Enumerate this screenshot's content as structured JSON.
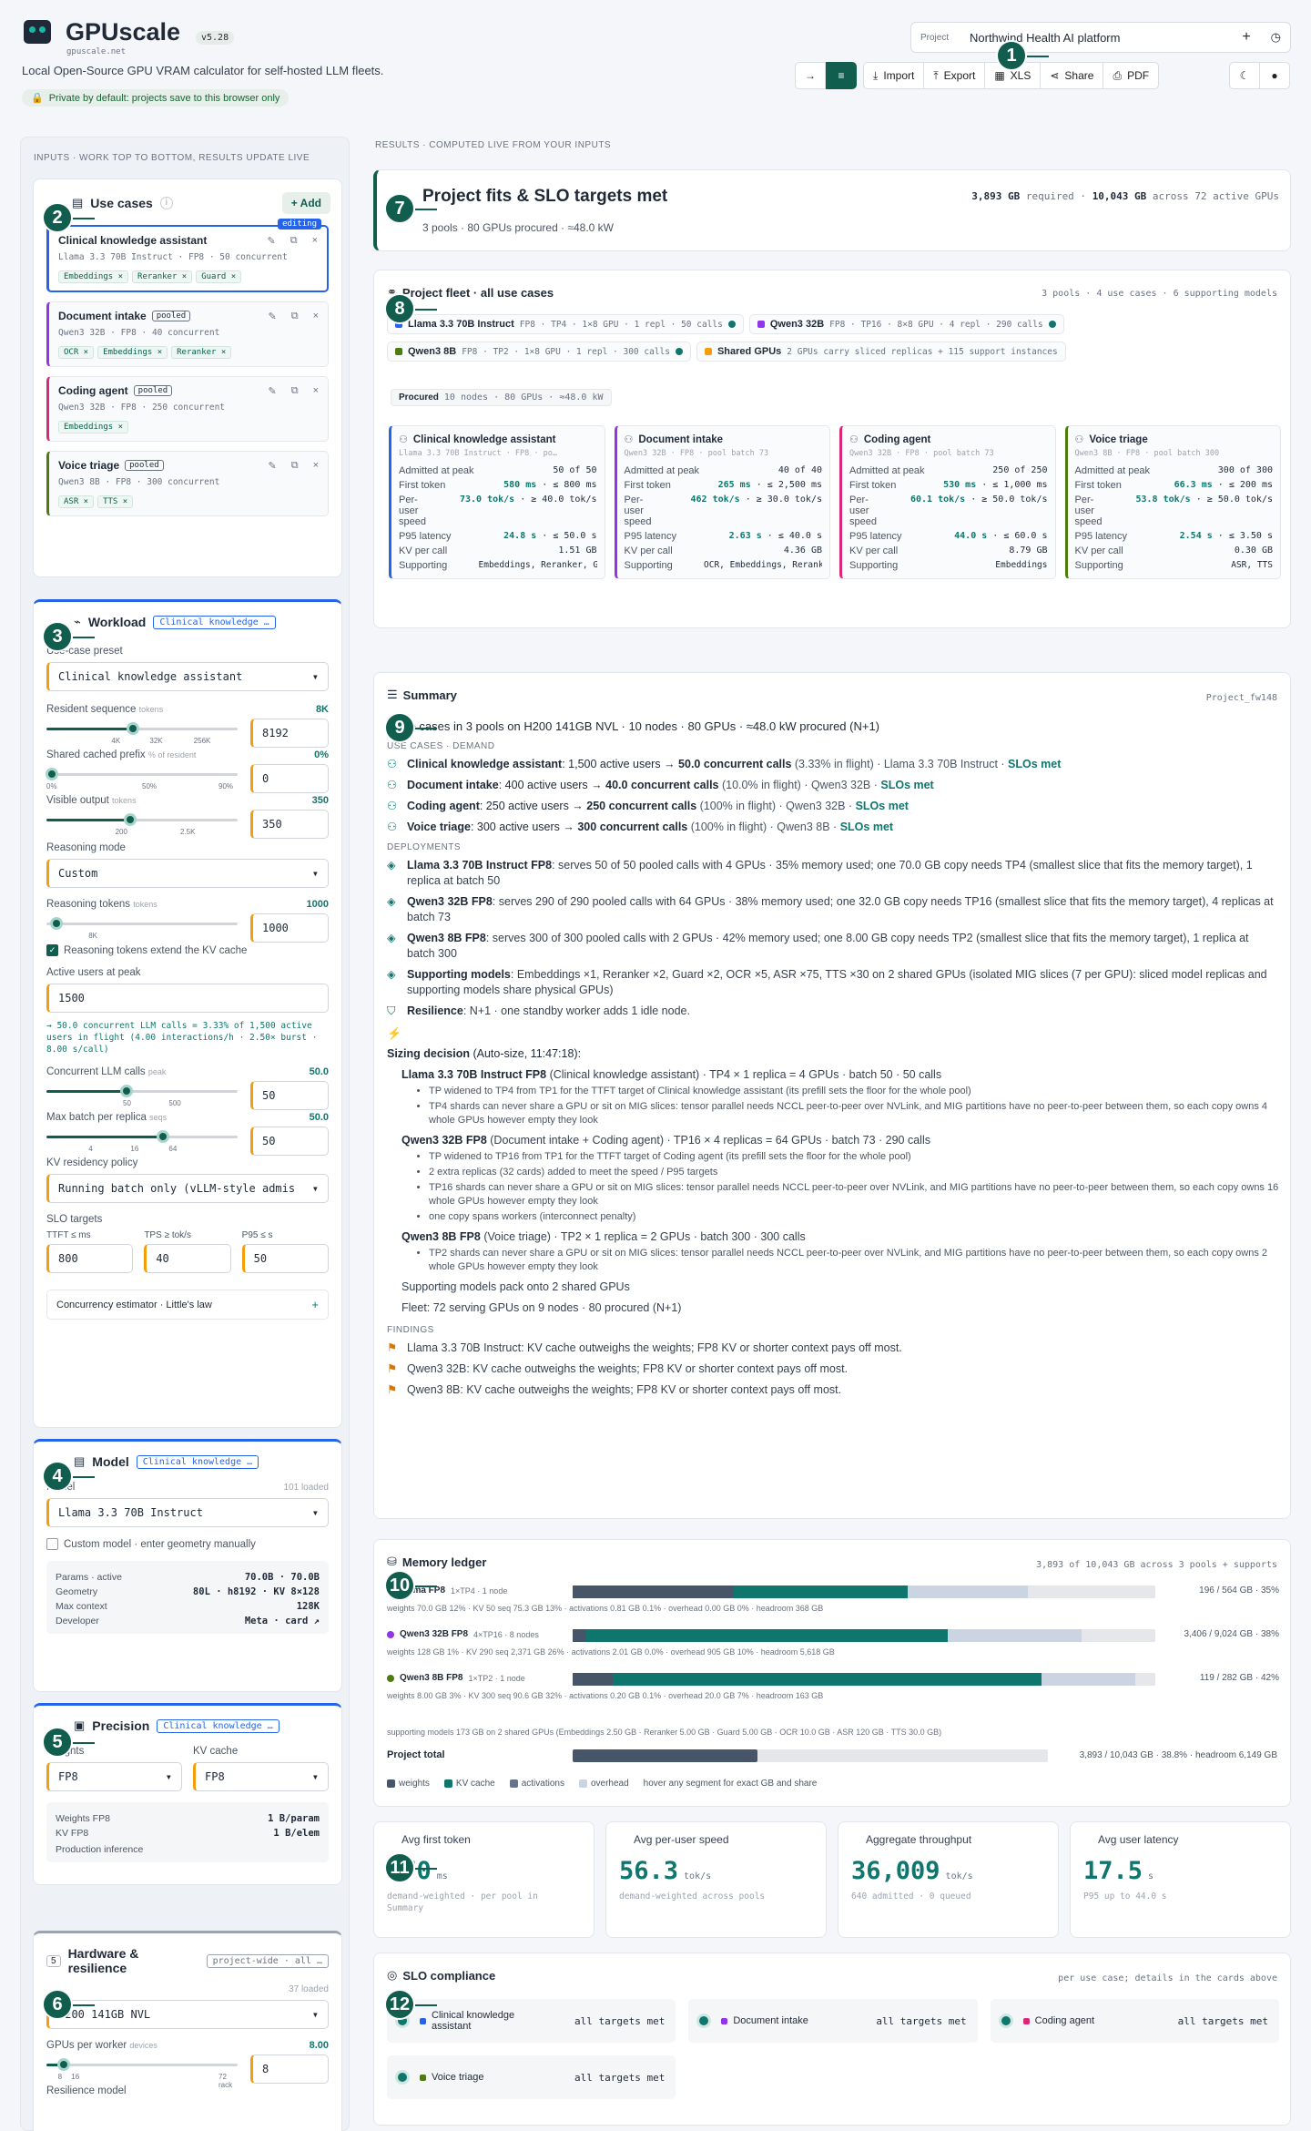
{
  "header": {
    "app_title": "GPUscale",
    "version": "v5.28",
    "site": "gpuscale.net",
    "tagline": "Local Open-Source GPU VRAM calculator for self-hosted LLM fleets.",
    "privacy": "Private by default: projects save to this browser only",
    "project_label": "Project",
    "project_name": "Northwind Health AI platform",
    "buttons": {
      "import": "Import",
      "export": "Export",
      "xls": "XLS",
      "share": "Share",
      "pdf": "PDF"
    }
  },
  "inputs_label": "INPUTS · WORK TOP TO BOTTOM, RESULTS UPDATE LIVE",
  "results_label": "RESULTS · COMPUTED LIVE FROM YOUR INPUTS",
  "usecases": {
    "title": "Use cases",
    "add": "+ Add",
    "editing_badge": "editing",
    "pooled_badge": "pooled",
    "items": [
      {
        "name": "Clinical knowledge assistant",
        "meta": "Llama 3.3 70B Instruct · FP8 · 50 concurrent",
        "chips": [
          "Embeddings ×",
          "Reranker ×",
          "Guard ×"
        ],
        "color": "#2563eb"
      },
      {
        "name": "Document intake",
        "meta": "Qwen3 32B · FP8 · 40 concurrent",
        "chips": [
          "OCR ×",
          "Embeddings ×",
          "Reranker ×"
        ],
        "color": "#9333ea"
      },
      {
        "name": "Coding agent",
        "meta": "Qwen3 32B · FP8 · 250 concurrent",
        "chips": [
          "Embeddings ×"
        ],
        "color": "#db2777"
      },
      {
        "name": "Voice triage",
        "meta": "Qwen3 8B · FP8 · 300 concurrent",
        "chips": [
          "ASR ×",
          "TTS ×"
        ],
        "color": "#4d7c0f"
      }
    ]
  },
  "workload": {
    "title": "Workload",
    "tag": "Clinical knowledge …",
    "preset_label": "Use-case preset",
    "preset": "Clinical knowledge assistant",
    "resident_label": "Resident sequence",
    "resident_unit": "tokens",
    "resident_value": "8K",
    "resident_input": "8192",
    "resident_ticks": [
      "4K",
      "32K",
      "256K"
    ],
    "prefix_label": "Shared cached prefix",
    "prefix_unit": "% of resident",
    "prefix_value": "0%",
    "prefix_input": "0",
    "prefix_ticks": [
      "0%",
      "50%",
      "90%"
    ],
    "visible_label": "Visible output",
    "visible_unit": "tokens",
    "visible_value": "350",
    "visible_input": "350",
    "visible_ticks": [
      "200",
      "2.5K"
    ],
    "reasoning_mode_label": "Reasoning mode",
    "reasoning_mode": "Custom",
    "reasoning_tokens_label": "Reasoning tokens",
    "reasoning_tokens_unit": "tokens",
    "reasoning_tokens_value": "1000",
    "reasoning_input": "1000",
    "reasoning_ticks": [
      "8K"
    ],
    "kv_extend": "Reasoning tokens extend the KV cache",
    "active_label": "Active users at peak",
    "active_input": "1500",
    "active_note": "→ 50.0 concurrent LLM calls = 3.33% of 1,500 active users in flight (4.00 interactions/h · 2.50× burst · 8.00 s/call)",
    "conc_label": "Concurrent LLM calls",
    "conc_unit": "peak",
    "conc_value": "50.0",
    "conc_input": "50",
    "conc_ticks": [
      "50",
      "500"
    ],
    "batch_label": "Max batch per replica",
    "batch_unit": "seqs",
    "batch_value": "50.0",
    "batch_input": "50",
    "batch_ticks": [
      "4",
      "16",
      "64"
    ],
    "kvpol_label": "KV residency policy",
    "kvpol": "Running batch only (vLLM-style admis",
    "slo_label": "SLO targets",
    "ttft_label": "TTFT ≤ ms",
    "tps_label": "TPS ≥ tok/s",
    "p95_label": "P95 ≤ s",
    "ttft": "800",
    "tps": "40",
    "p95": "50",
    "estimator": "Concurrency estimator · Little's law"
  },
  "model": {
    "title": "Model",
    "tag": "Clinical knowledge …",
    "model_label": "Model",
    "loaded": "101 loaded",
    "model": "Llama 3.3 70B Instruct",
    "custom": "Custom model · enter geometry manually",
    "specs": [
      {
        "k": "Params · active",
        "v": "70.0B · 70.0B"
      },
      {
        "k": "Geometry",
        "v": "80L · h8192 · KV 8×128"
      },
      {
        "k": "Max context",
        "v": "128K"
      },
      {
        "k": "Developer",
        "v": "Meta · card ↗"
      }
    ]
  },
  "precision": {
    "title": "Precision",
    "tag": "Clinical knowledge …",
    "weights_label": "Weights",
    "kv_label": "KV cache",
    "weights": "FP8",
    "kv": "FP8",
    "specs": [
      {
        "k": "Weights FP8",
        "v": "1 B/param"
      },
      {
        "k": "KV FP8",
        "v": "1 B/elem"
      }
    ],
    "note": "Production inference"
  },
  "hardware": {
    "title": "Hardware & resilience",
    "tag": "project-wide · all …",
    "loaded": "37 loaded",
    "gpu": "H200 141GB NVL",
    "gpw_label": "GPUs per worker",
    "gpw_unit": "devices",
    "gpw_value": "8.00",
    "gpw_input": "8",
    "gpw_ticks": [
      "8",
      "16",
      "72 rack"
    ],
    "resilience_label": "Resilience model"
  },
  "hero": {
    "title": "Project fits & SLO targets met",
    "sub": "3 pools · 80 GPUs procured · ≈48.0 kW",
    "req_num": "3,893 GB",
    "req_txt": "required ·",
    "avail_num": "10,043 GB",
    "avail_txt": "across 72 active GPUs"
  },
  "fleet": {
    "title": "Project fleet · all use cases",
    "meta": "3 pools · 4 use cases · 6 supporting models",
    "pools": [
      {
        "name": "Llama 3.3 70B Instruct",
        "detail": "FP8 · TP4 · 1×8 GPU · 1 repl · 50 calls",
        "color": "#2563eb"
      },
      {
        "name": "Qwen3 32B",
        "detail": "FP8 · TP16 · 8×8 GPU · 4 repl · 290 calls",
        "color": "#9333ea"
      },
      {
        "name": "Qwen3 8B",
        "detail": "FP8 · TP2 · 1×8 GPU · 1 repl · 300 calls",
        "color": "#4d7c0f"
      },
      {
        "name": "Shared GPUs",
        "detail": "2 GPUs carry sliced replicas + 115 support instances",
        "color": "#f59e0b"
      }
    ],
    "procured_label": "Procured",
    "procured": "10 nodes · 80 GPUs · ≈48.0 kW",
    "cards": [
      {
        "name": "Clinical knowledge assistant",
        "sub": "Llama 3.3 70B Instruct · FP8 · po…",
        "color": "#2563eb",
        "admitted": "50 of 50",
        "first": "580 ms",
        "first_t": "≤ 800 ms",
        "speed": "73.0 tok/s",
        "speed_t": "≥ 40.0 tok/s",
        "p95": "24.8 s",
        "p95_t": "≤ 50.0 s",
        "kv": "1.51 GB",
        "supporting": "Embeddings, Reranker, Guar"
      },
      {
        "name": "Document intake",
        "sub": "Qwen3 32B · FP8 · pool batch 73",
        "color": "#9333ea",
        "admitted": "40 of 40",
        "first": "265 ms",
        "first_t": "≤ 2,500 ms",
        "speed": "462 tok/s",
        "speed_t": "≥ 30.0 tok/s",
        "p95": "2.63 s",
        "p95_t": "≤ 40.0 s",
        "kv": "4.36 GB",
        "supporting": "OCR, Embeddings, Reranker"
      },
      {
        "name": "Coding agent",
        "sub": "Qwen3 32B · FP8 · pool batch 73",
        "color": "#db2777",
        "admitted": "250 of 250",
        "first": "530 ms",
        "first_t": "≤ 1,000 ms",
        "speed": "60.1 tok/s",
        "speed_t": "≥ 50.0 tok/s",
        "p95": "44.0 s",
        "p95_t": "≤ 60.0 s",
        "kv": "8.79 GB",
        "supporting": "Embeddings"
      },
      {
        "name": "Voice triage",
        "sub": "Qwen3 8B · FP8 · pool batch 300",
        "color": "#4d7c0f",
        "admitted": "300 of 300",
        "first": "66.3 ms",
        "first_t": "≤ 200 ms",
        "speed": "53.8 tok/s",
        "speed_t": "≥ 50.0 tok/s",
        "p95": "2.54 s",
        "p95_t": "≤ 3.50 s",
        "kv": "0.30 GB",
        "supporting": "ASR, TTS"
      }
    ],
    "labels": {
      "admitted": "Admitted at peak",
      "first": "First token",
      "speed": "Per-user speed",
      "p95": "P95 latency",
      "kv": "KV per call",
      "supporting": "Supporting"
    }
  },
  "summary": {
    "title": "Summary",
    "id": "Project_fw148",
    "lead": "4 use cases in 3 pools on H200 141GB NVL · 10 nodes · 80 GPUs · ≈48.0 kW procured (N+1)",
    "demand_label": "USE CASES · DEMAND",
    "demand": [
      {
        "name": "Clinical knowledge assistant",
        "a": ": 1,500 active users → ",
        "b": "50.0 concurrent calls",
        "c": " (3.33% in flight) · Llama 3.3 70B Instruct · ",
        "d": "SLOs met"
      },
      {
        "name": "Document intake",
        "a": ": 400 active users → ",
        "b": "40.0 concurrent calls",
        "c": " (10.0% in flight) · Qwen3 32B · ",
        "d": "SLOs met"
      },
      {
        "name": "Coding agent",
        "a": ": 250 active users → ",
        "b": "250 concurrent calls",
        "c": " (100% in flight) · Qwen3 32B · ",
        "d": "SLOs met"
      },
      {
        "name": "Voice triage",
        "a": ": 300 active users → ",
        "b": "300 concurrent calls",
        "c": " (100% in flight) · Qwen3 8B · ",
        "d": "SLOs met"
      }
    ],
    "deploy_label": "DEPLOYMENTS",
    "deployments": [
      {
        "name": "Llama 3.3 70B Instruct FP8",
        "text": ": serves 50 of 50 pooled calls with 4 GPUs · 35% memory used; one 70.0 GB copy needs TP4 (smallest slice that fits the memory target), 1 replica at batch 50"
      },
      {
        "name": "Qwen3 32B FP8",
        "text": ": serves 290 of 290 pooled calls with 64 GPUs · 38% memory used; one 32.0 GB copy needs TP16 (smallest slice that fits the memory target), 4 replicas at batch 73"
      },
      {
        "name": "Qwen3 8B FP8",
        "text": ": serves 300 of 300 pooled calls with 2 GPUs · 42% memory used; one 8.00 GB copy needs TP2 (smallest slice that fits the memory target), 1 replica at batch 300"
      },
      {
        "name": "Supporting models",
        "text": ": Embeddings ×1, Reranker ×2, Guard ×2, OCR ×5, ASR ×75, TTS ×30 on 2 shared GPUs (isolated MIG slices (7 per GPU): sliced model replicas and supporting models share physical GPUs)"
      },
      {
        "name": "Resilience",
        "text": ": N+1 · one standby worker adds 1 idle node."
      }
    ],
    "sizing_title": "Sizing decision",
    "sizing_meta": " (Auto-size, 11:47:18):",
    "sizing": [
      {
        "head": "Llama 3.3 70B Instruct FP8",
        "rest": " (Clinical knowledge assistant) · TP4 × 1 replica = 4 GPUs · batch 50 · 50 calls",
        "bullets": [
          "TP widened to TP4 from TP1 for the TTFT target of Clinical knowledge assistant (its prefill sets the floor for the whole pool)",
          "TP4 shards can never share a GPU or sit on MIG slices: tensor parallel needs NCCL peer-to-peer over NVLink, and MIG partitions have no peer-to-peer between them, so each copy owns 4 whole GPUs however empty they look"
        ]
      },
      {
        "head": "Qwen3 32B FP8",
        "rest": " (Document intake + Coding agent) · TP16 × 4 replicas = 64 GPUs · batch 73 · 290 calls",
        "bullets": [
          "TP widened to TP16 from TP1 for the TTFT target of Coding agent (its prefill sets the floor for the whole pool)",
          "2 extra replicas (32 cards) added to meet the speed / P95 targets",
          "TP16 shards can never share a GPU or sit on MIG slices: tensor parallel needs NCCL peer-to-peer over NVLink, and MIG partitions have no peer-to-peer between them, so each copy owns 16 whole GPUs however empty they look",
          "one copy spans workers (interconnect penalty)"
        ]
      },
      {
        "head": "Qwen3 8B FP8",
        "rest": " (Voice triage) · TP2 × 1 replica = 2 GPUs · batch 300 · 300 calls",
        "bullets": [
          "TP2 shards can never share a GPU or sit on MIG slices: tensor parallel needs NCCL peer-to-peer over NVLink, and MIG partitions have no peer-to-peer between them, so each copy owns 2 whole GPUs however empty they look"
        ]
      }
    ],
    "sizing_tail": [
      "Supporting models pack onto 2 shared GPUs",
      "Fleet: 72 serving GPUs on 9 nodes · 80 procured (N+1)"
    ],
    "findings_label": "FINDINGS",
    "findings": [
      "Llama 3.3 70B Instruct: KV cache outweighs the weights; FP8 KV or shorter context pays off most.",
      "Qwen3 32B: KV cache outweighs the weights; FP8 KV or shorter context pays off most.",
      "Qwen3 8B: KV cache outweighs the weights; FP8 KV or shorter context pays off most."
    ]
  },
  "ledger": {
    "title": "Memory ledger",
    "meta": "3,893 of 10,043 GB across 3 pools + supports",
    "rows": [
      {
        "name": "Llama FP8",
        "tp": "1×TP4 · 1 node",
        "detail": "weights 70.0 GB 12% · KV 50 seq 75.3 GB 13% · activations 0.81 GB 0.1% · overhead 0.00 GB 0% · headroom 368 GB",
        "stat": "196 / 564 GB · 35%",
        "w": 0.12,
        "kv": 0.13,
        "act": 0.0,
        "ov": 0.09,
        "color": "#2563eb"
      },
      {
        "name": "Qwen3 32B FP8",
        "tp": "4×TP16 · 8 nodes",
        "detail": "weights 128 GB 1% · KV 290 seq 2,371 GB 26% · activations 2.01 GB 0.0% · overhead 905 GB 10% · headroom 5,618 GB",
        "stat": "3,406 / 9,024 GB · 38%",
        "w": 0.01,
        "kv": 0.27,
        "act": 0.0,
        "ov": 0.1,
        "color": "#9333ea"
      },
      {
        "name": "Qwen3 8B FP8",
        "tp": "1×TP2 · 1 node",
        "detail": "weights 8.00 GB 3% · KV 300 seq 90.6 GB 32% · activations 0.20 GB 0.1% · overhead 20.0 GB 7% · headroom 163 GB",
        "stat": "119 / 282 GB · 42%",
        "w": 0.03,
        "kv": 0.32,
        "act": 0.0,
        "ov": 0.07,
        "color": "#4d7c0f"
      }
    ],
    "supporting": "supporting models 173 GB on 2 shared GPUs (Embeddings 2.50 GB · Reranker 5.00 GB · Guard 5.00 GB · OCR 10.0 GB · ASR 120 GB · TTS 30.0 GB)",
    "total_label": "Project total",
    "total_stat": "3,893 / 10,043 GB · 38.8% · headroom 6,149 GB",
    "total_fill": 0.388,
    "legend": [
      "weights",
      "KV cache",
      "activations",
      "overhead"
    ],
    "legend_hint": "hover any segment for exact GB and share"
  },
  "metrics": [
    {
      "title": "Avg first token",
      "value": "370",
      "unit": "ms",
      "note": "demand-weighted · per pool in Summary"
    },
    {
      "title": "Avg per-user speed",
      "value": "56.3",
      "unit": "tok/s",
      "note": "demand-weighted across pools"
    },
    {
      "title": "Aggregate throughput",
      "value": "36,009",
      "unit": "tok/s",
      "note": "640 admitted · 0 queued"
    },
    {
      "title": "Avg user latency",
      "value": "17.5",
      "unit": "s",
      "note": "P95 up to 44.0 s"
    }
  ],
  "slo": {
    "title": "SLO compliance",
    "meta": "per use case; details in the cards above",
    "items": [
      {
        "name": "Clinical knowledge assistant",
        "status": "all targets met",
        "color": "#2563eb"
      },
      {
        "name": "Document intake",
        "status": "all targets met",
        "color": "#9333ea"
      },
      {
        "name": "Coding agent",
        "status": "all targets met",
        "color": "#db2777"
      },
      {
        "name": "Voice triage",
        "status": "all targets met",
        "color": "#4d7c0f"
      }
    ]
  },
  "markers": [
    "1",
    "2",
    "3",
    "4",
    "5",
    "6",
    "7",
    "8",
    "9",
    "10",
    "11",
    "12"
  ],
  "colors": {
    "accent": "#115e4f",
    "teal": "#0f766e",
    "orange": "#f59e0b",
    "blue": "#2563eb"
  }
}
